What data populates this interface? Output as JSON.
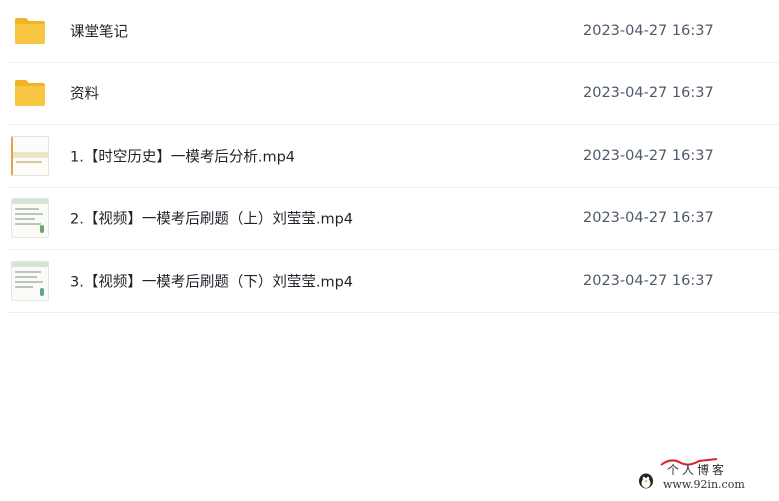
{
  "files": [
    {
      "type": "folder",
      "icon": "folder-icon",
      "name": "课堂笔记",
      "modified": "2023-04-27 16:37"
    },
    {
      "type": "folder",
      "icon": "folder-icon",
      "name": "资料",
      "modified": "2023-04-27 16:37"
    },
    {
      "type": "video",
      "icon": "video-thumbnail",
      "name": "1.【时空历史】一模考后分析.mp4",
      "modified": "2023-04-27 16:37"
    },
    {
      "type": "video",
      "icon": "video-thumbnail",
      "name": "2.【视频】一模考后刷题（上）刘莹莹.mp4",
      "modified": "2023-04-27 16:37"
    },
    {
      "type": "video",
      "icon": "video-thumbnail",
      "name": "3.【视频】一模考后刷题（下）刘莹莹.mp4",
      "modified": "2023-04-27 16:37"
    }
  ],
  "colors": {
    "folder": "#f7c744",
    "folder_back": "#f0b429",
    "divider": "#eeeff1",
    "text": "#1f2329",
    "time_text": "#4e5969",
    "watermark_accent": "#d9262c"
  },
  "watermark": {
    "title": "个人博客",
    "url": "www.92in.com"
  }
}
